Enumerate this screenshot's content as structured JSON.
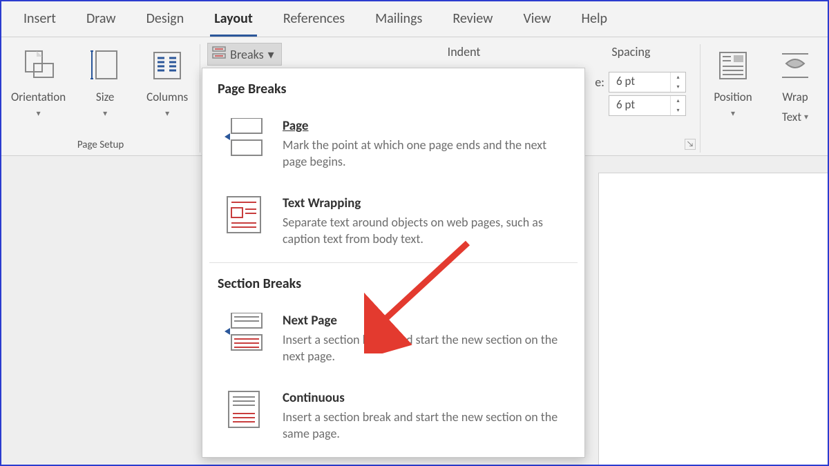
{
  "tabs": {
    "items": [
      {
        "label": "Insert"
      },
      {
        "label": "Draw"
      },
      {
        "label": "Design"
      },
      {
        "label": "Layout"
      },
      {
        "label": "References"
      },
      {
        "label": "Mailings"
      },
      {
        "label": "Review"
      },
      {
        "label": "View"
      },
      {
        "label": "Help"
      }
    ],
    "active_index": 3
  },
  "ribbon": {
    "page_setup": {
      "orientation": "Orientation",
      "size": "Size",
      "columns": "Columns",
      "breaks": "Breaks",
      "group_label": "Page Setup"
    },
    "paragraph": {
      "indent_label": "Indent",
      "spacing_label": "Spacing",
      "before_prefix": "e:",
      "spinner_before": "6 pt",
      "spinner_after": "6 pt"
    },
    "arrange": {
      "position": "Position",
      "wrap_text_line1": "Wrap",
      "wrap_text_line2": "Text"
    }
  },
  "breaks_menu": {
    "page_breaks_header": "Page Breaks",
    "section_breaks_header": "Section Breaks",
    "items": {
      "page": {
        "title": "Page",
        "desc": "Mark the point at which one page ends and the next page begins."
      },
      "text_wrapping": {
        "title": "Text Wrapping",
        "desc": "Separate text around objects on web pages, such as caption text from body text."
      },
      "next_page": {
        "title": "Next Page",
        "desc": "Insert a section break and start the new section on the next page."
      },
      "continuous": {
        "title": "Continuous",
        "desc": "Insert a section break and start the new section on the same page."
      }
    }
  }
}
